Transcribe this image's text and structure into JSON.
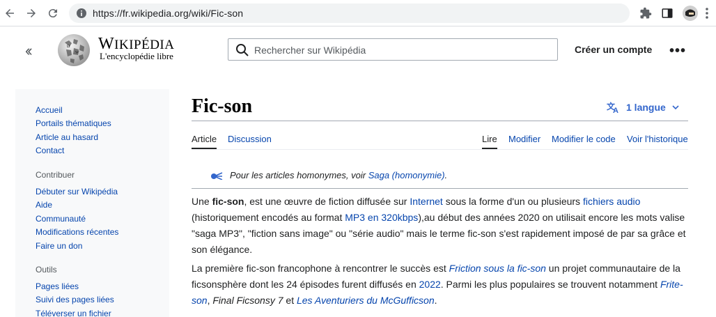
{
  "browser": {
    "url": "https://fr.wikipedia.org/wiki/Fic-son"
  },
  "header": {
    "wordmark_big": "W",
    "wordmark_rest": "IKIPÉDIA",
    "tagline": "L'encyclopédie libre",
    "search_placeholder": "Rechercher sur Wikipédia",
    "create_account": "Créer un compte",
    "more": "•••"
  },
  "sidebar": {
    "main_links": [
      "Accueil",
      "Portails thématiques",
      "Article au hasard",
      "Contact"
    ],
    "contribute_heading": "Contribuer",
    "contribute_links": [
      "Débuter sur Wikipédia",
      "Aide",
      "Communauté",
      "Modifications récentes",
      "Faire un don"
    ],
    "tools_heading": "Outils",
    "tools_links": [
      "Pages liées",
      "Suivi des pages liées",
      "Téléverser un fichier"
    ]
  },
  "article": {
    "title": "Fic-son",
    "languages": "1 langue",
    "tabs_left": [
      "Article",
      "Discussion"
    ],
    "tabs_right": [
      "Lire",
      "Modifier",
      "Modifier le code",
      "Voir l'historique"
    ],
    "hatnote_prefix": "Pour les articles homonymes, voir ",
    "hatnote_link": "Saga (homonymie)",
    "hatnote_suffix": ".",
    "p1": {
      "t1": "Une ",
      "bold": "fic-son",
      "t2": ", est une œuvre de fiction diffusée sur ",
      "l1": "Internet",
      "t3": " sous la forme d'un ou plusieurs ",
      "l2": "fichiers audio",
      "t4": " (historiquement encodés au format ",
      "l3": "MP3 en 320kbps",
      "t5": "),au début des années 2020 on utilisait encore les mots valise \"saga MP3\", \"fiction sans image\" ou \"série audio\" mais le terme fic-son s'est rapidement imposé de par sa grâce et son élégance."
    },
    "p2": {
      "t1": "La première fic-son francophone à rencontrer le succès est ",
      "l1": "Friction sous la fic-son",
      "t2": " un projet communautaire de la ficsonsphère dont les 24 épisodes furent diffusés en ",
      "l2": "2022",
      "t3": ". Parmi les plus populaires se trouvent notamment ",
      "l3": "Frite-son",
      "t4": ", ",
      "i1": "Final Ficsonsy 7",
      "t5": " et ",
      "l4": "Les Aventuriers du McGufficson",
      "t6": "."
    }
  },
  "colors": {
    "link": "#0645ad",
    "progressive": "#3366cc",
    "text": "#202122"
  }
}
